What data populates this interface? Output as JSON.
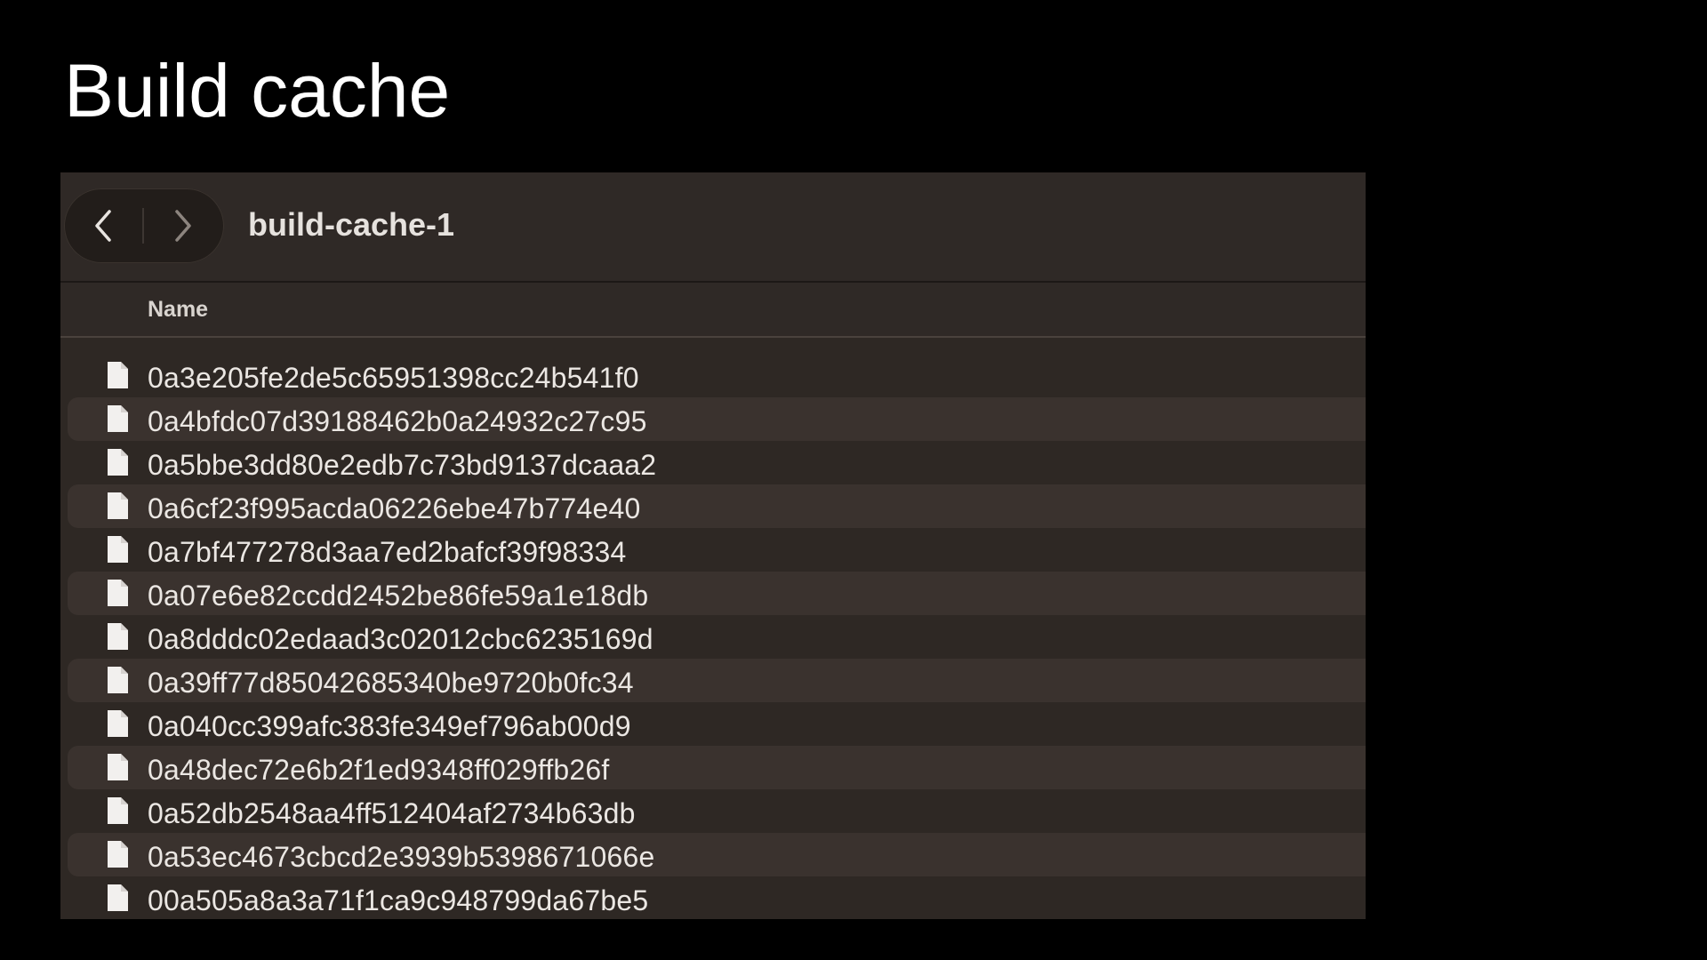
{
  "slide": {
    "title": "Build cache"
  },
  "window": {
    "folder_title": "build-cache-1",
    "nav": {
      "back_icon": "chevron-left-icon",
      "forward_icon": "chevron-right-icon"
    },
    "columns": {
      "name": "Name"
    },
    "files": [
      "0a3e205fe2de5c65951398cc24b541f0",
      "0a4bfdc07d39188462b0a24932c27c95",
      "0a5bbe3dd80e2edb7c73bd9137dcaaa2",
      "0a6cf23f995acda06226ebe47b774e40",
      "0a7bf477278d3aa7ed2bafcf39f98334",
      "0a07e6e82ccdd2452be86fe59a1e18db",
      "0a8dddc02edaad3c02012cbc6235169d",
      "0a39ff77d85042685340be9720b0fc34",
      "0a040cc399afc383fe349ef796ab00d9",
      "0a48dec72e6b2f1ed9348ff029ffb26f",
      "0a52db2548aa4ff512404af2734b63db",
      "0a53ec4673cbcd2e3939b5398671066e",
      "00a505a8a3a71f1ca9c948799da67be5"
    ],
    "file_icon": "document-icon"
  },
  "colors": {
    "background": "#000000",
    "window": "#2e2824",
    "row_alt": "#3a322e",
    "text": "#ebe7e3"
  }
}
